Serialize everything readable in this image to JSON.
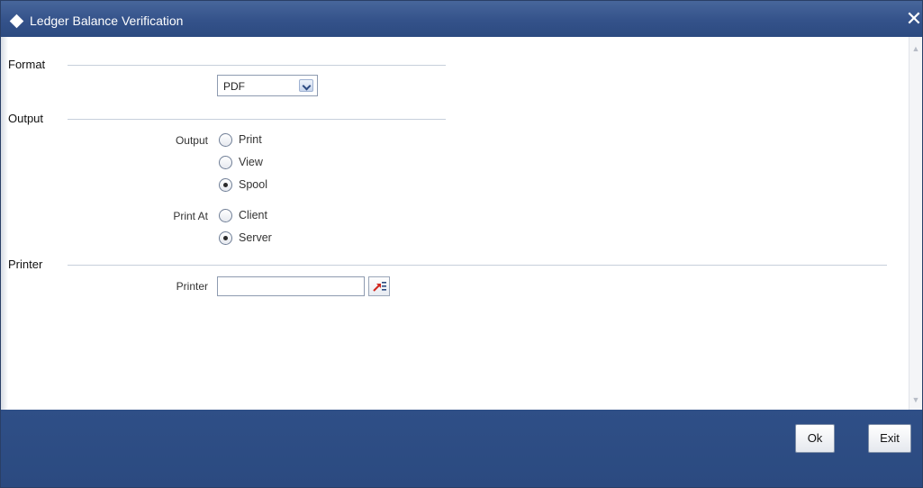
{
  "window": {
    "title": "Ledger Balance Verification",
    "close_glyph": "✕"
  },
  "format": {
    "section_label": "Format",
    "selected": "PDF"
  },
  "output": {
    "section_label": "Output",
    "output_label": "Output",
    "options": [
      "Print",
      "View",
      "Spool"
    ],
    "selected_option": "Spool",
    "print_at_label": "Print At",
    "print_at_options": [
      "Client",
      "Server"
    ],
    "selected_print_at": "Server"
  },
  "printer": {
    "section_label": "Printer",
    "field_label": "Printer",
    "value": ""
  },
  "footer": {
    "ok_label": "Ok",
    "exit_label": "Exit"
  },
  "colors": {
    "title_bar": "#34528a",
    "footer": "#2c4a80",
    "lov_icon": "#d0261e"
  },
  "icons": {
    "title": "diamond-icon",
    "close": "close-icon",
    "dropdown": "chevron-down-icon",
    "lov": "list-of-values-icon"
  }
}
